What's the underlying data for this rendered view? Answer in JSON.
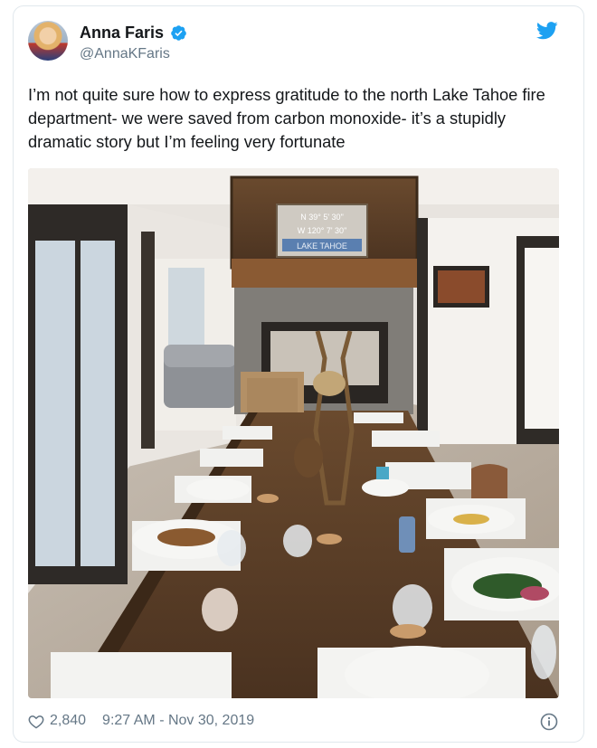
{
  "author": {
    "name": "Anna Faris",
    "handle": "@AnnaKFaris",
    "verified": true
  },
  "tweet": {
    "text": "I’m not quite sure how to express gratitude to the north Lake Tahoe fire department- we were saved from carbon monoxide- it’s a stupidly dramatic story but I’m feeling very fortunate"
  },
  "photo": {
    "sign_lines": [
      "N 39° 5' 30\"",
      "W 120° 7' 30\"",
      "LAKE TAHOE"
    ]
  },
  "footer": {
    "likes": "2,840",
    "time": "9:27 AM - Nov 30, 2019"
  },
  "colors": {
    "brand": "#1da1f2",
    "secondary_text": "#657786",
    "border": "#e1e8ed"
  },
  "icons": [
    "verified-badge-icon",
    "twitter-bird-icon",
    "heart-icon",
    "info-icon"
  ]
}
